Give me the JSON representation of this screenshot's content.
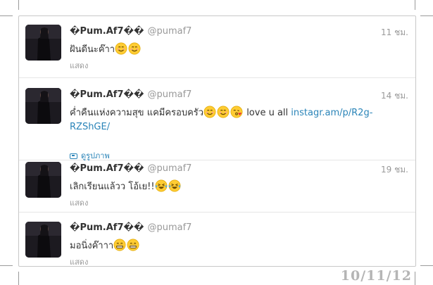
{
  "tweets": [
    {
      "name": "�Pum.Af7��",
      "handle": "@pumaf7",
      "time": "11 ชม.",
      "text_before": "ฝันดีนะค๊าา",
      "emoji": [
        "smile",
        "smile"
      ],
      "text_after": "",
      "link": "",
      "action": "แสดง"
    },
    {
      "name": "�Pum.Af7��",
      "handle": "@pumaf7",
      "time": "14 ชม.",
      "text_before": "ค่ำคืนแห่งความสุข แคมีครอบครัว",
      "emoji": [
        "smile",
        "smile",
        "kiss"
      ],
      "text_after": " love u all ",
      "link": "instagr.am/p/R2g-RZShGE/",
      "action": "ดูรูปภาพ"
    },
    {
      "name": "�Pum.Af7��",
      "handle": "@pumaf7",
      "time": "19 ชม.",
      "text_before": "เลิกเรียนแล้วว โอ้เย!!",
      "emoji": [
        "laugh",
        "laugh"
      ],
      "text_after": "",
      "link": "",
      "action": "แสดง"
    },
    {
      "name": "�Pum.Af7��",
      "handle": "@pumaf7",
      "time": "",
      "text_before": "มอนิ่งค๊าาา",
      "emoji": [
        "grin",
        "grin"
      ],
      "text_after": "",
      "link": "",
      "action": "แสดง"
    }
  ],
  "stamp": "10/11/12",
  "colors": {
    "link": "#2a84b8",
    "text": "#333333",
    "muted": "#999999",
    "border": "#e6e6e6",
    "emoji_face": "#ffcc33"
  }
}
